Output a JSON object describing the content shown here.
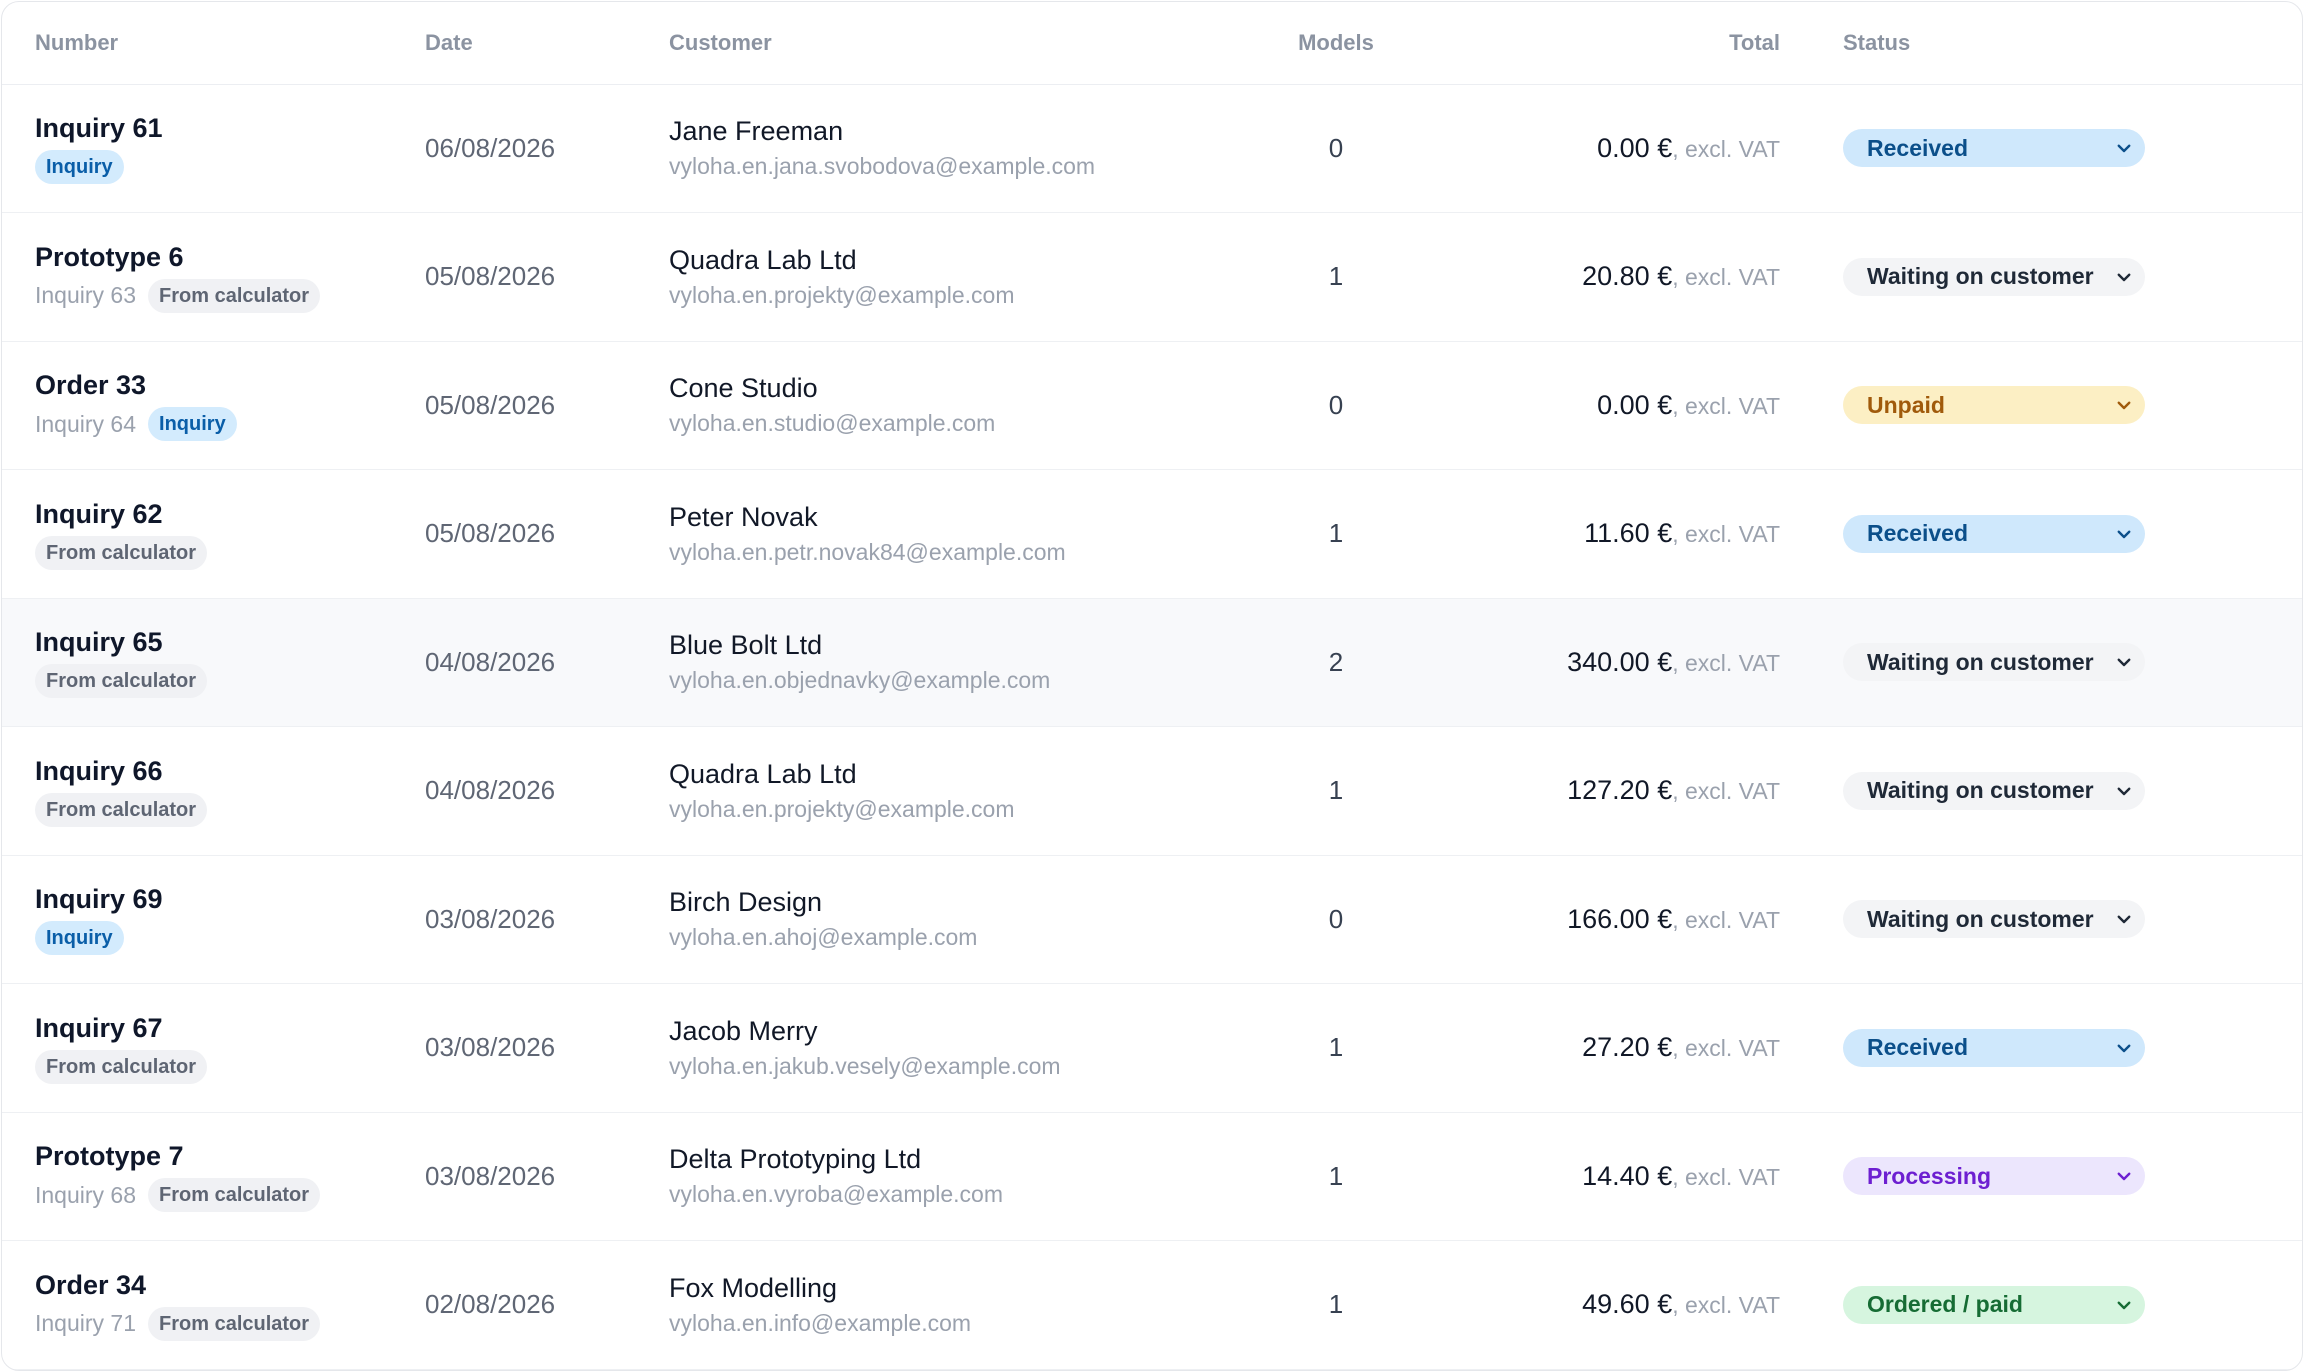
{
  "headers": {
    "number": "Number",
    "date": "Date",
    "customer": "Customer",
    "models": "Models",
    "total": "Total",
    "status": "Status"
  },
  "currency_suffix": ", excl. VAT",
  "colors": {
    "received": "#cfe8fc",
    "waiting": "#f3f4f6",
    "unpaid": "#fcefc4",
    "processing": "#ece6fd",
    "paid": "#d6f5df"
  },
  "rows": [
    {
      "title": "Inquiry 61",
      "ref": "",
      "tag": "Inquiry",
      "date": "06/08/2026",
      "customer": "Jane Freeman",
      "email": "vyloha.en.jana.svobodova@example.com",
      "models": "0",
      "total": "0.00 €",
      "status": "Received"
    },
    {
      "title": "Prototype 6",
      "ref": "Inquiry 63",
      "tag": "From calculator",
      "date": "05/08/2026",
      "customer": "Quadra Lab Ltd",
      "email": "vyloha.en.projekty@example.com",
      "models": "1",
      "total": "20.80 €",
      "status": "Waiting on customer"
    },
    {
      "title": "Order 33",
      "ref": "Inquiry 64",
      "tag": "Inquiry",
      "date": "05/08/2026",
      "customer": "Cone Studio",
      "email": "vyloha.en.studio@example.com",
      "models": "0",
      "total": "0.00 €",
      "status": "Unpaid"
    },
    {
      "title": "Inquiry 62",
      "ref": "",
      "tag": "From calculator",
      "date": "05/08/2026",
      "customer": "Peter Novak",
      "email": "vyloha.en.petr.novak84@example.com",
      "models": "1",
      "total": "11.60 €",
      "status": "Received"
    },
    {
      "title": "Inquiry 65",
      "ref": "",
      "tag": "From calculator",
      "date": "04/08/2026",
      "customer": "Blue Bolt Ltd",
      "email": "vyloha.en.objednavky@example.com",
      "models": "2",
      "total": "340.00 €",
      "status": "Waiting on customer"
    },
    {
      "title": "Inquiry 66",
      "ref": "",
      "tag": "From calculator",
      "date": "04/08/2026",
      "customer": "Quadra Lab Ltd",
      "email": "vyloha.en.projekty@example.com",
      "models": "1",
      "total": "127.20 €",
      "status": "Waiting on customer"
    },
    {
      "title": "Inquiry 69",
      "ref": "",
      "tag": "Inquiry",
      "date": "03/08/2026",
      "customer": "Birch Design",
      "email": "vyloha.en.ahoj@example.com",
      "models": "0",
      "total": "166.00 €",
      "status": "Waiting on customer"
    },
    {
      "title": "Inquiry 67",
      "ref": "",
      "tag": "From calculator",
      "date": "03/08/2026",
      "customer": "Jacob Merry",
      "email": "vyloha.en.jakub.vesely@example.com",
      "models": "1",
      "total": "27.20 €",
      "status": "Received"
    },
    {
      "title": "Prototype 7",
      "ref": "Inquiry 68",
      "tag": "From calculator",
      "date": "03/08/2026",
      "customer": "Delta Prototyping Ltd",
      "email": "vyloha.en.vyroba@example.com",
      "models": "1",
      "total": "14.40 €",
      "status": "Processing"
    },
    {
      "title": "Order 34",
      "ref": "Inquiry 71",
      "tag": "From calculator",
      "date": "02/08/2026",
      "customer": "Fox Modelling",
      "email": "vyloha.en.info@example.com",
      "models": "1",
      "total": "49.60 €",
      "status": "Ordered / paid"
    }
  ]
}
